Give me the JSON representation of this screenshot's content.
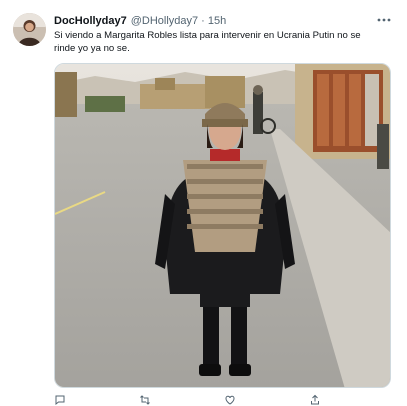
{
  "tweet": {
    "display_name": "DocHollyday7",
    "handle": "@DHollyday7",
    "separator": "·",
    "time": "15h",
    "text": "Si viendo a Margarita Robles lista para intervenir en Ucrania Putin no se rinde yo ya no se.",
    "more_icon": "ellipsis-icon"
  },
  "actions": {
    "reply_count": "",
    "retweet_count": "",
    "like_count": "",
    "share_icon": "share-icon"
  },
  "colors": {
    "text_primary": "#0f1419",
    "text_secondary": "#536471",
    "border": "#cfd9de"
  }
}
